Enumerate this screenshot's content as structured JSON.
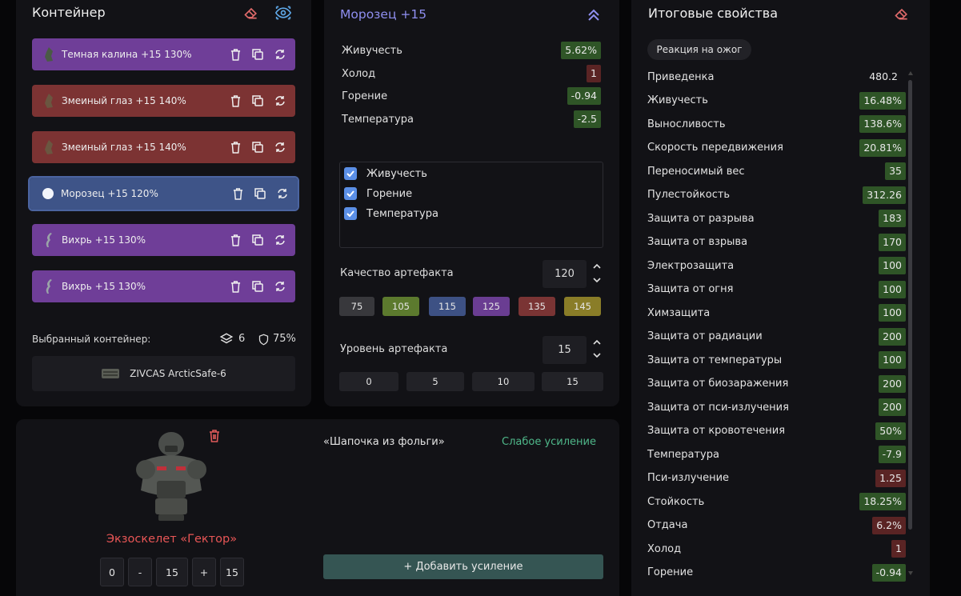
{
  "container": {
    "title": "Контейнер",
    "artifacts": [
      {
        "label": "Темная калина  +15  130%",
        "color": "purple"
      },
      {
        "label": "Змеиный глаз  +15  140%",
        "color": "red"
      },
      {
        "label": "Змеиный глаз  +15  140%",
        "color": "red"
      },
      {
        "label": "Морозец  +15  120%",
        "color": "blue"
      },
      {
        "label": "Вихрь  +15  130%",
        "color": "purple"
      },
      {
        "label": "Вихрь  +15  130%",
        "color": "purple"
      }
    ],
    "selected_label": "Выбранный контейнер:",
    "slots": "6",
    "protection": "75%",
    "container_name": "ZIVCAS ArcticSafe-6"
  },
  "artifact": {
    "title": "Морозец +15",
    "stats": [
      {
        "label": "Живучесть",
        "value": "5.62%",
        "tone": "g"
      },
      {
        "label": "Холод",
        "value": "1",
        "tone": "r"
      },
      {
        "label": "Горение",
        "value": "-0.94",
        "tone": "g"
      },
      {
        "label": "Температура",
        "value": "-2.5",
        "tone": "g"
      }
    ],
    "checks": [
      "Живучесть",
      "Горение",
      "Температура"
    ],
    "quality_label": "Качество артефакта",
    "quality_value": "120",
    "quality_options": [
      {
        "label": "75",
        "color": "#38383c"
      },
      {
        "label": "105",
        "color": "#5c7a2e"
      },
      {
        "label": "115",
        "color": "#3d5184"
      },
      {
        "label": "125",
        "color": "#6a3d92"
      },
      {
        "label": "135",
        "color": "#7a3434"
      },
      {
        "label": "145",
        "color": "#8a7d28"
      }
    ],
    "level_label": "Уровень артефакта",
    "level_value": "15",
    "level_options": [
      "0",
      "5",
      "10",
      "15"
    ]
  },
  "final": {
    "title": "Итоговые свойства",
    "reaction_button": "Реакция на ожог",
    "rows": [
      {
        "label": "Приведенка",
        "value": "480.2",
        "tone": ""
      },
      {
        "label": "Живучесть",
        "value": "16.48%",
        "tone": "g"
      },
      {
        "label": "Выносливость",
        "value": "138.6%",
        "tone": "g"
      },
      {
        "label": "Скорость передвижения",
        "value": "20.81%",
        "tone": "g"
      },
      {
        "label": "Переносимый вес",
        "value": "35",
        "tone": "g"
      },
      {
        "label": "Пулестойкость",
        "value": "312.26",
        "tone": "g"
      },
      {
        "label": "Защита от разрыва",
        "value": "183",
        "tone": "g"
      },
      {
        "label": "Защита от взрыва",
        "value": "170",
        "tone": "g"
      },
      {
        "label": "Электрозащита",
        "value": "100",
        "tone": "g"
      },
      {
        "label": "Защита от огня",
        "value": "100",
        "tone": "g"
      },
      {
        "label": "Химзащита",
        "value": "100",
        "tone": "g"
      },
      {
        "label": "Защита от радиации",
        "value": "200",
        "tone": "g"
      },
      {
        "label": "Защита от температуры",
        "value": "100",
        "tone": "g"
      },
      {
        "label": "Защита от биозаражения",
        "value": "200",
        "tone": "g"
      },
      {
        "label": "Защита от пси-излучения",
        "value": "200",
        "tone": "g"
      },
      {
        "label": "Защита от кровотечения",
        "value": "50%",
        "tone": "g"
      },
      {
        "label": "Температура",
        "value": "-7.9",
        "tone": "g"
      },
      {
        "label": "Пси-излучение",
        "value": "1.25",
        "tone": "r"
      },
      {
        "label": "Стойкость",
        "value": "18.25%",
        "tone": "g"
      },
      {
        "label": "Отдача",
        "value": "6.2%",
        "tone": "r"
      },
      {
        "label": "Холод",
        "value": "1",
        "tone": "r"
      },
      {
        "label": "Горение",
        "value": "-0.94",
        "tone": "g"
      }
    ]
  },
  "armor": {
    "name": "Экзоскелет «Гектор»",
    "upgrade_name": "«Шапочка из фольги»",
    "upgrade_tag": "Слабое усиление",
    "add_button": "+ Добавить усиление",
    "min": "0",
    "minus": "-",
    "value": "15",
    "plus": "+",
    "max": "15"
  }
}
